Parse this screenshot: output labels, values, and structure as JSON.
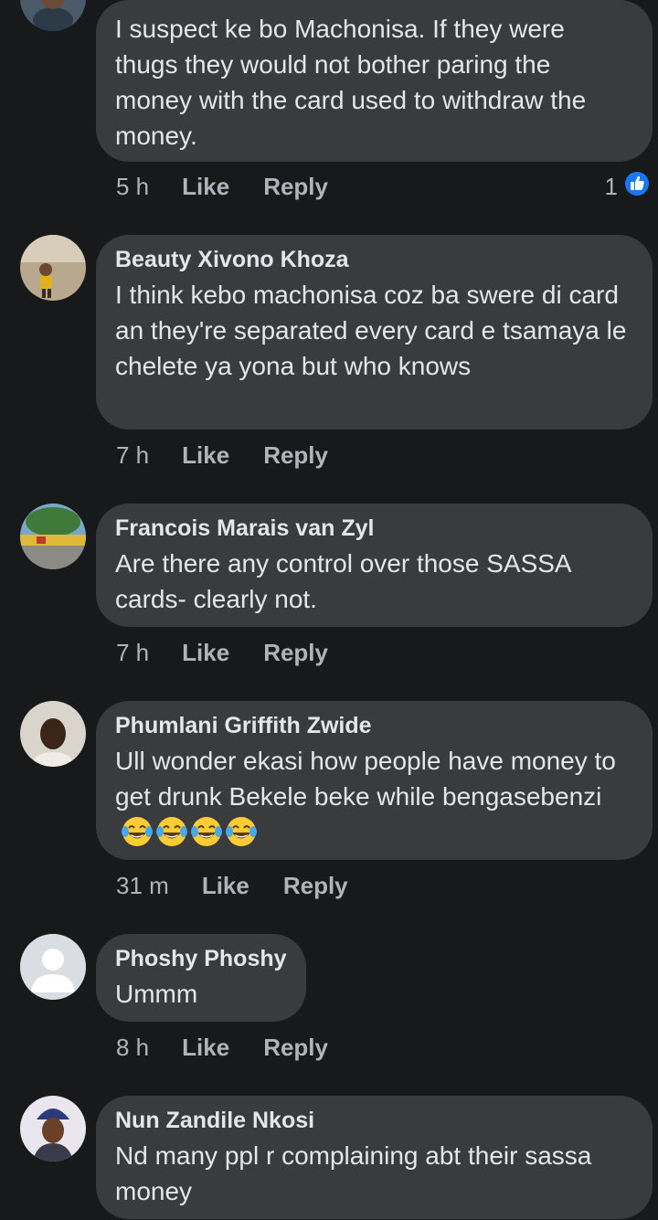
{
  "comments": [
    {
      "author": "",
      "text": "I suspect ke bo Machonisa. If they were thugs they would not bother paring the money with the card used to withdraw the money.",
      "time": "5 h",
      "like": "Like",
      "reply": "Reply",
      "reaction_count": "1"
    },
    {
      "author": "Beauty Xivono Khoza",
      "text": "I think kebo machonisa coz ba swere di card an they're separated every card e tsamaya le chelete ya yona but who knows",
      "time": "7 h",
      "like": "Like",
      "reply": "Reply"
    },
    {
      "author": "Francois Marais van Zyl",
      "text": "Are there any control over those SASSA cards- clearly not.",
      "time": "7 h",
      "like": "Like",
      "reply": "Reply"
    },
    {
      "author": "Phumlani Griffith Zwide",
      "text": "Ull wonder ekasi how people have money to get drunk Bekele beke while bengasebenzi",
      "emoji": [
        "tears-of-joy-icon",
        "tears-of-joy-icon",
        "tears-of-joy-icon",
        "tears-of-joy-icon"
      ],
      "time": "31 m",
      "like": "Like",
      "reply": "Reply"
    },
    {
      "author": "Phoshy Phoshy",
      "text": "Ummm",
      "time": "8 h",
      "like": "Like",
      "reply": "Reply"
    },
    {
      "author": "Nun Zandile Nkosi",
      "text": "Nd many ppl r complaining abt their sassa money"
    }
  ],
  "colors": {
    "background": "#18191a",
    "bubble": "#3a3b3c",
    "text": "#e4e6eb",
    "secondary_text": "#b0b3b8",
    "like_badge": "#1877f2"
  }
}
